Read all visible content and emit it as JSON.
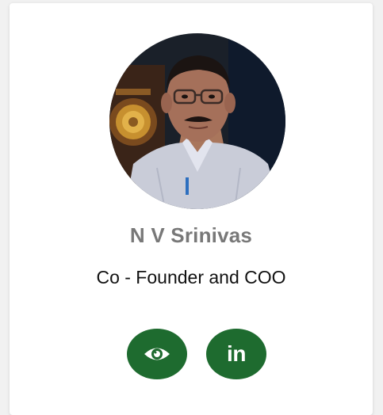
{
  "profile": {
    "name": "N V Srinivas",
    "role": "Co - Founder and COO"
  },
  "actions": {
    "view_icon": "eye-icon",
    "linkedin_icon": "linkedin-icon",
    "linkedin_glyph": "in"
  },
  "colors": {
    "accent": "#1e6b2f",
    "name_text": "#787878",
    "role_text": "#111111",
    "card_bg": "#ffffff",
    "page_bg": "#f1f1f1"
  }
}
